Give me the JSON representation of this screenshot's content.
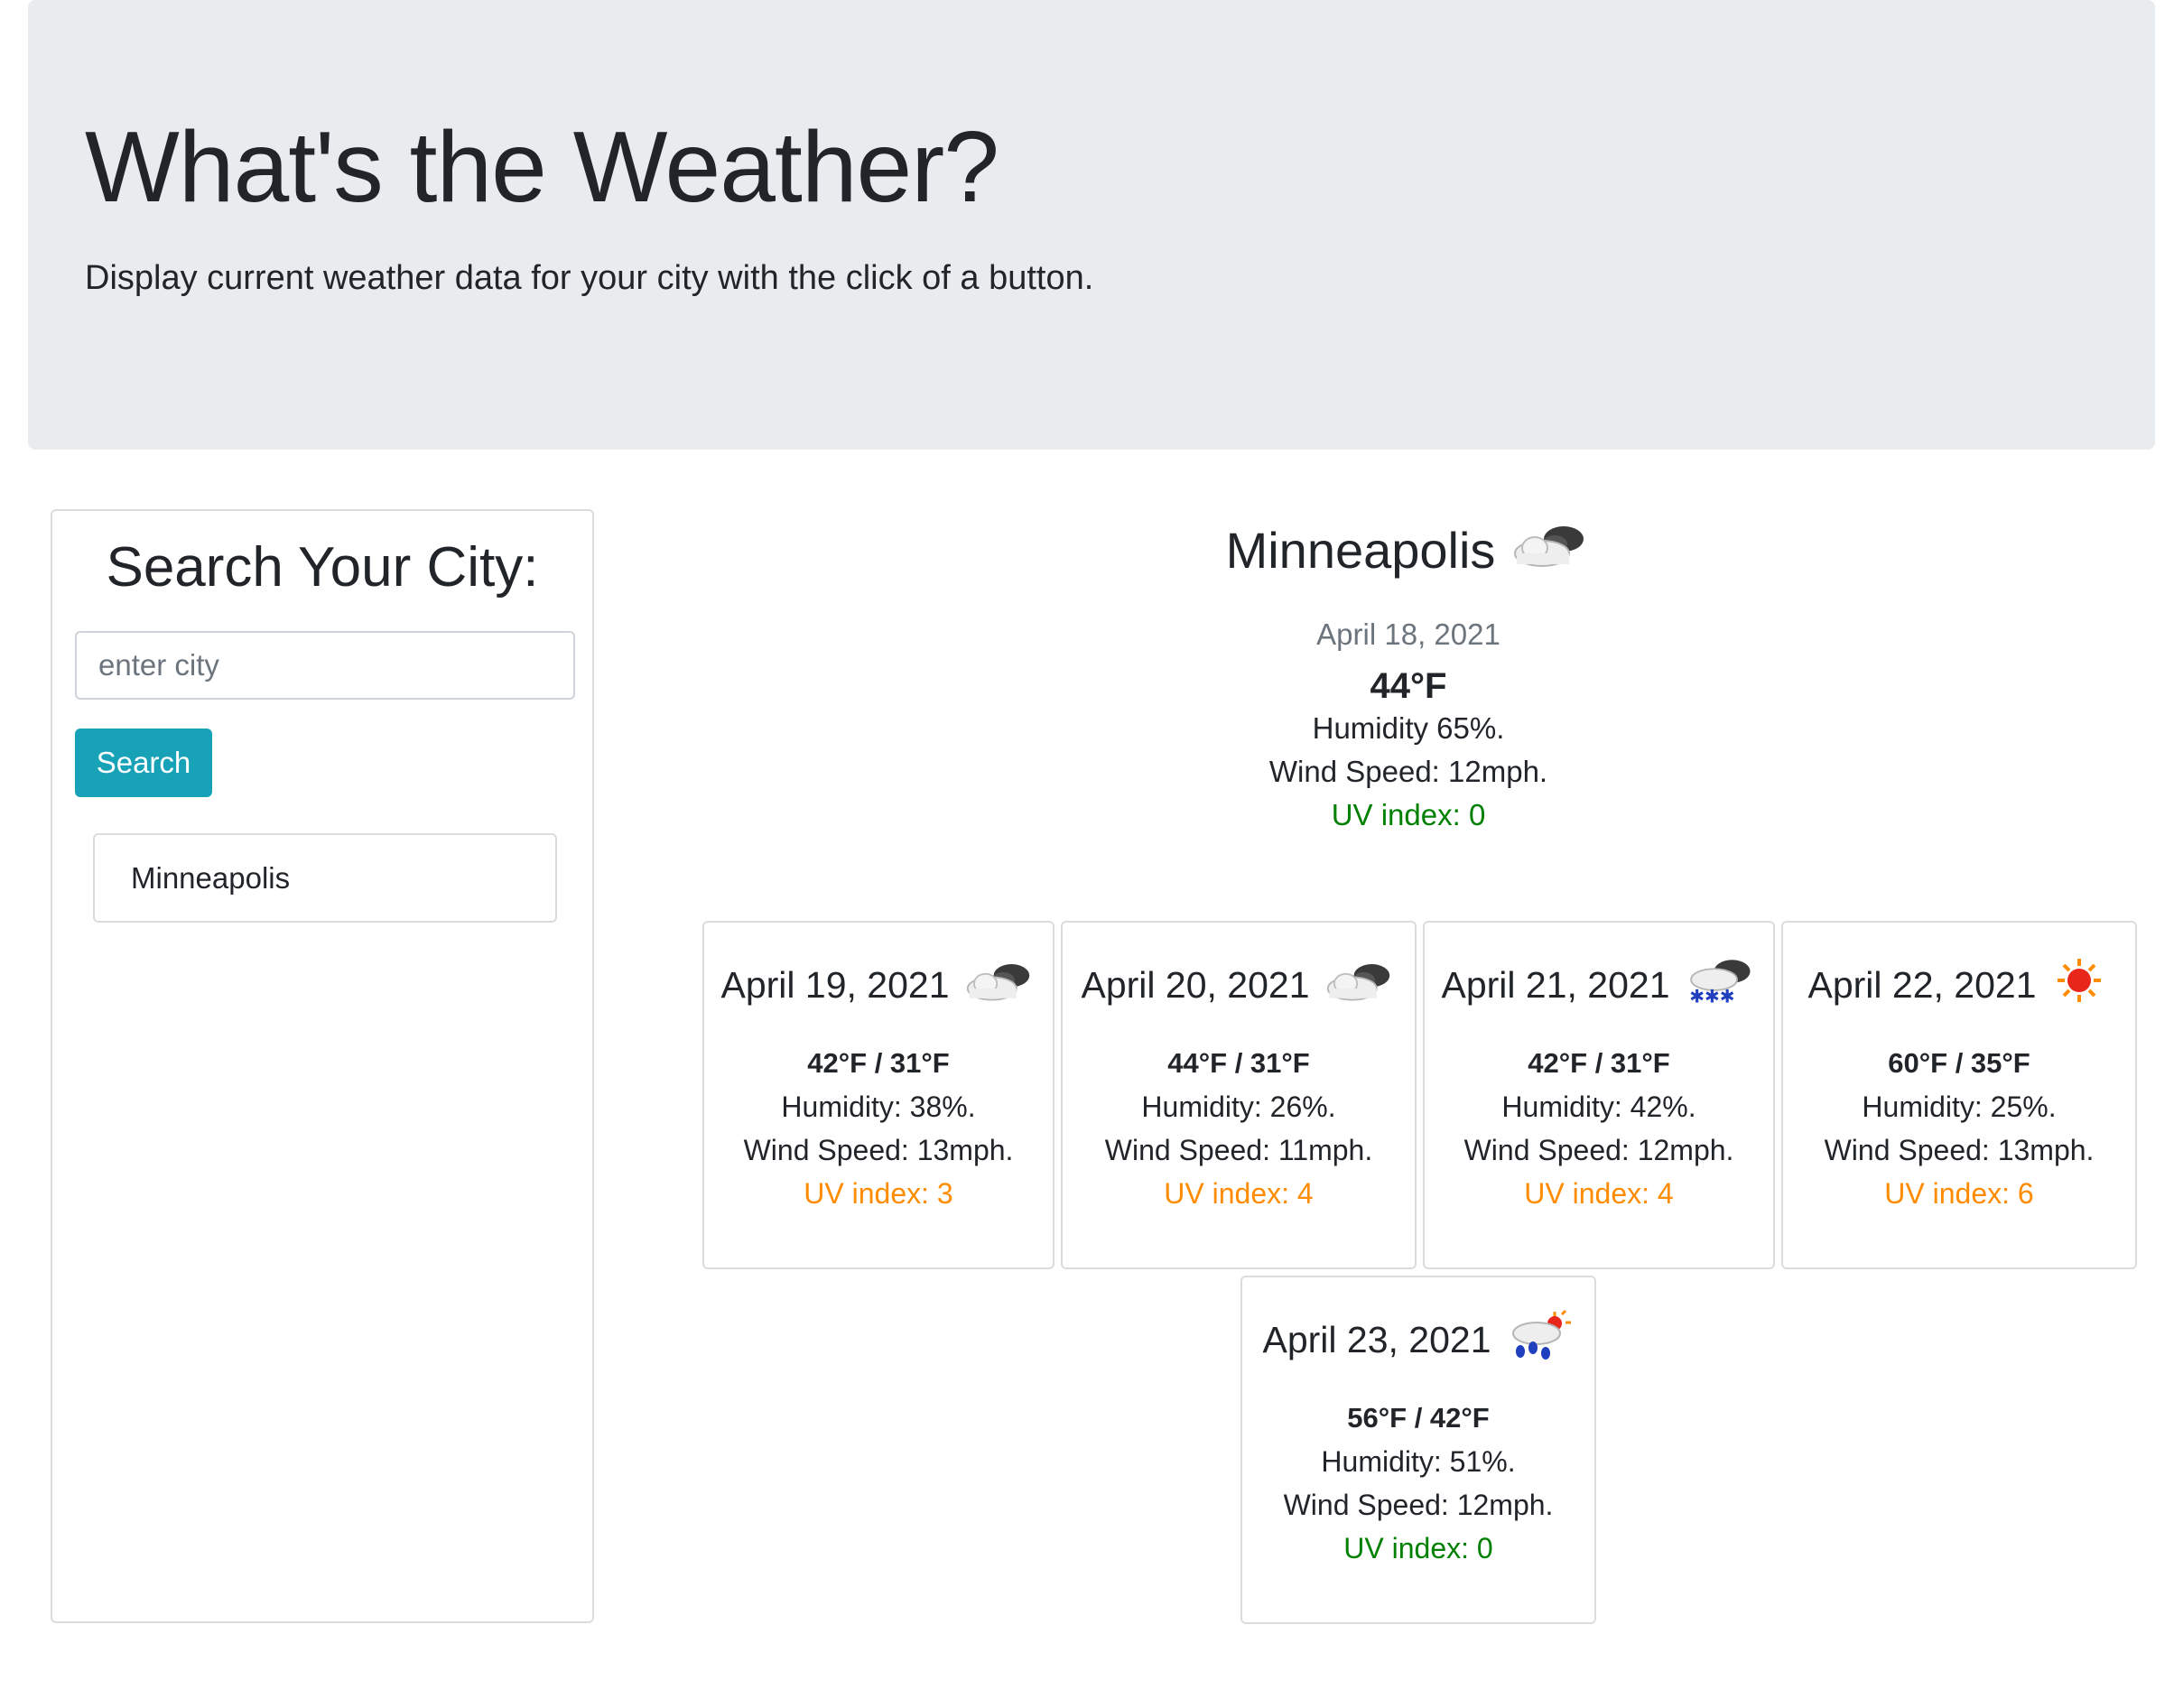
{
  "header": {
    "title": "What's the Weather?",
    "subtitle": "Display current weather data for your city with the click of a button."
  },
  "sidebar": {
    "heading": "Search Your City:",
    "search_placeholder": "enter city",
    "search_value": "",
    "search_button": "Search",
    "history": [
      "Minneapolis"
    ]
  },
  "current": {
    "city": "Minneapolis",
    "icon": "cloudy-icon",
    "date": "April 18, 2021",
    "temp": "44°F",
    "humidity": "Humidity 65%.",
    "wind": "Wind Speed: 12mph.",
    "uv": "UV index: 0",
    "uv_color": "#008000"
  },
  "forecast": [
    {
      "date": "April 19, 2021",
      "icon": "cloudy-icon",
      "temp": "42°F / 31°F",
      "humidity": "Humidity: 38%.",
      "wind": "Wind Speed: 13mph.",
      "uv": "UV index: 3",
      "uv_color": "#ff8c00"
    },
    {
      "date": "April 20, 2021",
      "icon": "cloudy-icon",
      "temp": "44°F / 31°F",
      "humidity": "Humidity: 26%.",
      "wind": "Wind Speed: 11mph.",
      "uv": "UV index: 4",
      "uv_color": "#ff8c00"
    },
    {
      "date": "April 21, 2021",
      "icon": "snow-icon",
      "temp": "42°F / 31°F",
      "humidity": "Humidity: 42%.",
      "wind": "Wind Speed: 12mph.",
      "uv": "UV index: 4",
      "uv_color": "#ff8c00"
    },
    {
      "date": "April 22, 2021",
      "icon": "sun-icon",
      "temp": "60°F / 35°F",
      "humidity": "Humidity: 25%.",
      "wind": "Wind Speed: 13mph.",
      "uv": "UV index: 6",
      "uv_color": "#ff8c00"
    },
    {
      "date": "April 23, 2021",
      "icon": "rain-sun-icon",
      "temp": "56°F / 42°F",
      "humidity": "Humidity: 51%.",
      "wind": "Wind Speed: 12mph.",
      "uv": "UV index: 0",
      "uv_color": "#008000"
    }
  ]
}
